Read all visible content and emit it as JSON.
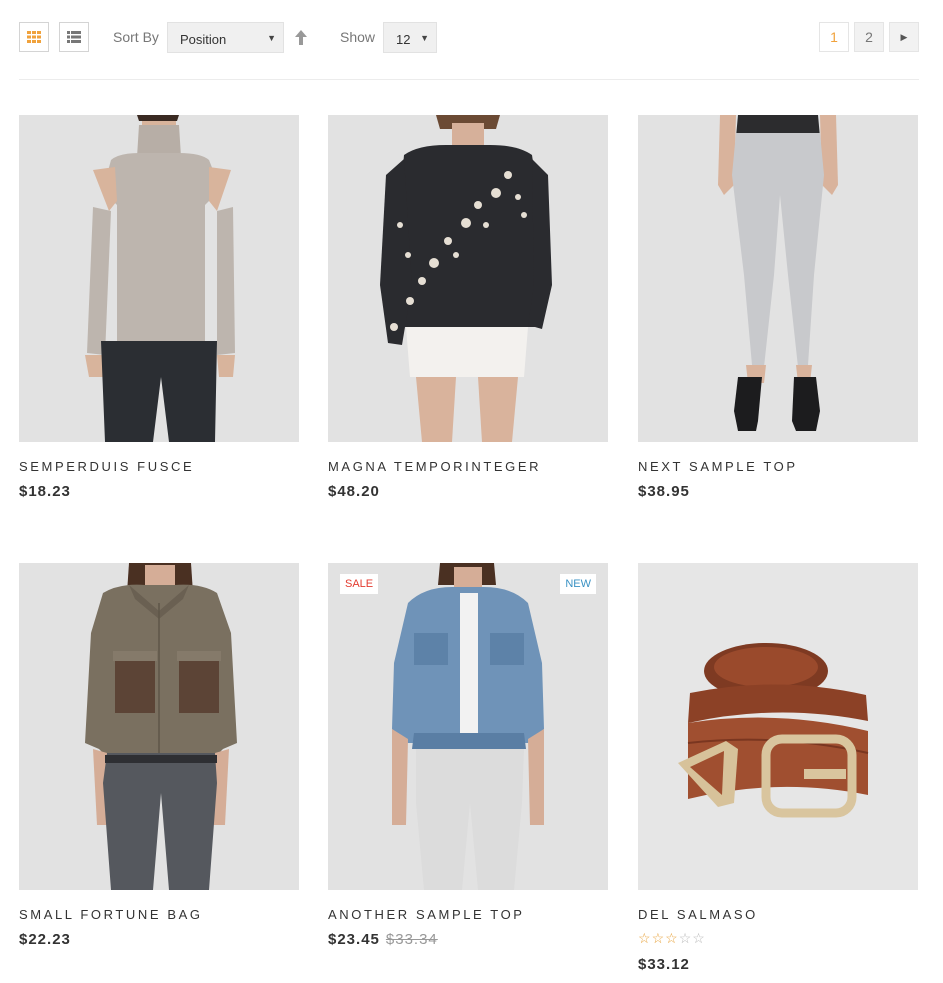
{
  "toolbar": {
    "sort_label": "Sort By",
    "sort_value": "Position",
    "show_label": "Show",
    "limit_value": "12",
    "pages": [
      "1",
      "2"
    ],
    "current_page": "1"
  },
  "colors": {
    "accent": "#f0a23c",
    "sale": "#e33a2e",
    "new": "#3a92c4"
  },
  "products": [
    {
      "name": "SEMPERDUIS FUSCE",
      "price": "$18.23"
    },
    {
      "name": "MAGNA TEMPORINTEGER",
      "price": "$48.20"
    },
    {
      "name": "NEXT SAMPLE TOP",
      "price": "$38.95"
    },
    {
      "name": "SMALL FORTUNE BAG",
      "price": "$22.23"
    },
    {
      "name": "ANOTHER SAMPLE TOP",
      "price": "$23.45",
      "old_price": "$33.34",
      "badge_sale": "SALE",
      "badge_new": "NEW"
    },
    {
      "name": "DEL SALMASO",
      "price": "$33.12",
      "rating": 3,
      "rating_max": 5
    }
  ]
}
